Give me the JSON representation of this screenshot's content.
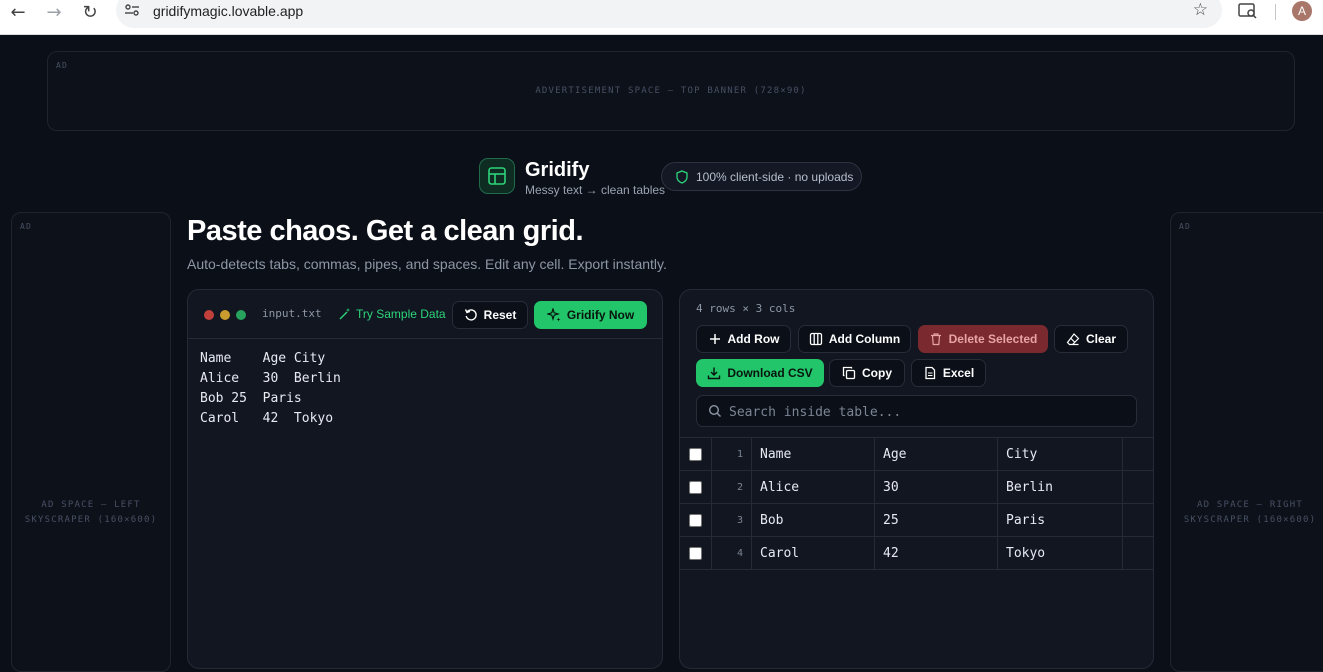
{
  "browser": {
    "url": "gridifymagic.lovable.app",
    "avatar_letter": "A"
  },
  "ads": {
    "tag": "AD",
    "top_banner": "ADVERTISEMENT SPACE — TOP BANNER (728×90)",
    "left_skyscraper": "AD SPACE — LEFT SKYSCRAPER (160×600)",
    "right_skyscraper": "AD SPACE — RIGHT SKYSCRAPER (160×600)"
  },
  "brand": {
    "name": "Gridify",
    "tagline": "Messy text → clean tables",
    "badge": "100% client-side · no uploads"
  },
  "hero": {
    "headline": "Paste chaos. Get a clean grid.",
    "subline": "Auto-detects tabs, commas, pipes, and spaces. Edit any cell. Export instantly."
  },
  "input_panel": {
    "filename": "input.txt",
    "try_sample": "Try Sample Data",
    "reset": "Reset",
    "gridify": "Gridify Now",
    "content": "Name    Age City\nAlice   30  Berlin\nBob 25  Paris\nCarol   42  Tokyo"
  },
  "output_panel": {
    "info": "4 rows × 3 cols",
    "add_row": "Add Row",
    "add_column": "Add Column",
    "delete_selected": "Delete Selected",
    "clear": "Clear",
    "download_csv": "Download CSV",
    "copy": "Copy",
    "excel": "Excel",
    "search_placeholder": "Search inside table...",
    "rows": [
      {
        "num": "1",
        "cells": [
          "Name",
          "Age",
          "City"
        ]
      },
      {
        "num": "2",
        "cells": [
          "Alice",
          "30",
          "Berlin"
        ]
      },
      {
        "num": "3",
        "cells": [
          "Bob",
          "25",
          "Paris"
        ]
      },
      {
        "num": "4",
        "cells": [
          "Carol",
          "42",
          "Tokyo"
        ]
      }
    ]
  },
  "colors": {
    "accent": "#22c56a",
    "danger": "#7a2a2e",
    "background": "#0b0f17"
  }
}
